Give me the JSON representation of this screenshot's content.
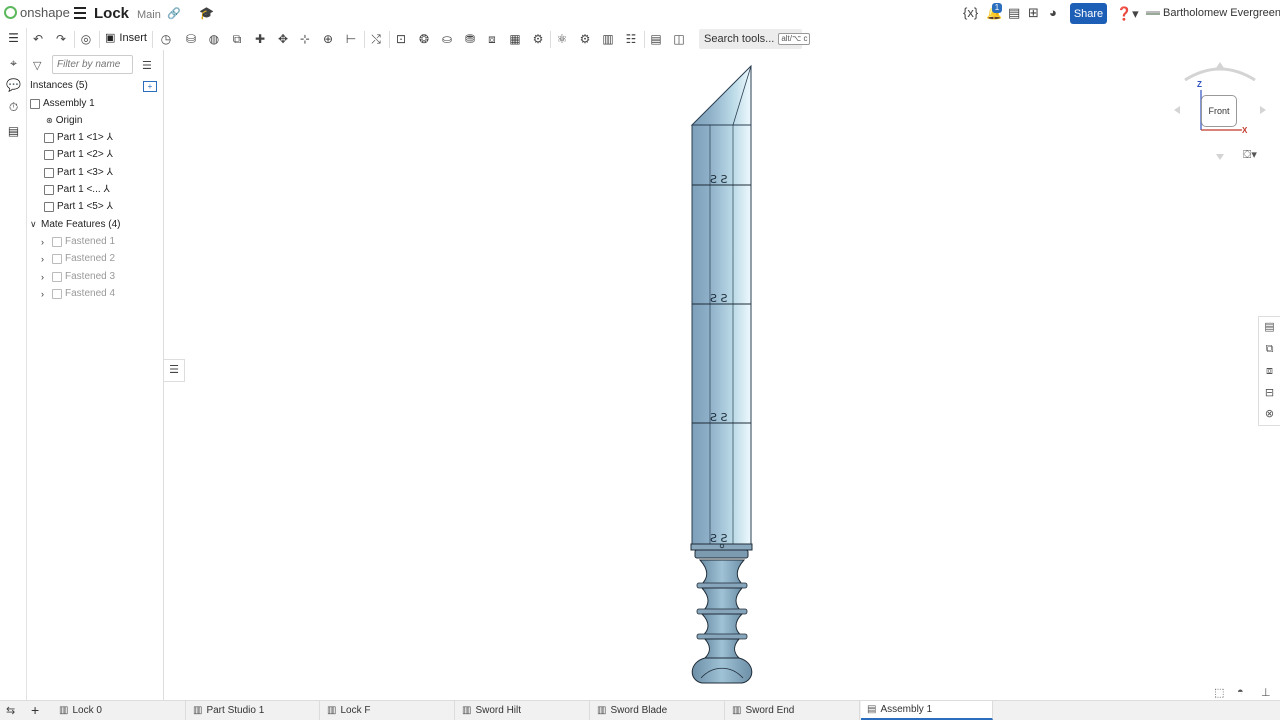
{
  "header": {
    "brand": "onshape",
    "doc_title": "Lock",
    "branch": "Main",
    "notification_count": "1",
    "share_label": "Share",
    "user_name": "Bartholomew Evergreen",
    "icons": [
      "variable-studio-icon",
      "notification-icon",
      "document-icon",
      "apps-icon",
      "learning-icon",
      "help-icon"
    ]
  },
  "toolbar": {
    "insert_label": "Insert",
    "search_label": "Search tools...",
    "search_shortcut": "alt/⌥ c",
    "icons": [
      "undo-icon",
      "redo-icon",
      "render-icon",
      "insert-icon",
      "mate-connector-icon",
      "fastened-mate-icon",
      "revolute-mate-icon",
      "slider-mate-icon",
      "planar-mate-icon",
      "cylindrical-mate-icon",
      "pin-slot-mate-icon",
      "ball-mate-icon",
      "parallel-mate-icon",
      "tangent-mate-icon",
      "group-icon",
      "replicate-icon",
      "mate-relation-icon",
      "gear-relation-icon",
      "rack-pinion-icon",
      "screw-relation-icon",
      "linear-relation-icon",
      "explode-icon",
      "section-view-icon",
      "measure-icon",
      "mass-properties-icon"
    ]
  },
  "left_panel": {
    "filter_placeholder": "Filter by name",
    "instances_header": "Instances (5)",
    "assembly": "Assembly 1",
    "origin": "Origin",
    "parts": [
      "Part 1 <1>",
      "Part 1 <2>",
      "Part 1 <3>",
      "Part 1 <...",
      "Part 1 <5>"
    ],
    "mate_features_header": "Mate Features (4)",
    "mates": [
      "Fastened 1",
      "Fastened 2",
      "Fastened 3",
      "Fastened 4"
    ]
  },
  "viewcube": {
    "face": "Front",
    "axis_z": "Z",
    "axis_x": "X"
  },
  "model": {
    "name": "sword-assembly",
    "blade_fill": "#86a9c3",
    "blade_highlight": "#eaf6fb",
    "segments": 4
  },
  "tabs": [
    {
      "label": "Lock 0",
      "active": false
    },
    {
      "label": "Part Studio 1",
      "active": false
    },
    {
      "label": "Lock F",
      "active": false
    },
    {
      "label": "Sword Hilt",
      "active": false
    },
    {
      "label": "Sword Blade",
      "active": false
    },
    {
      "label": "Sword End",
      "active": false
    },
    {
      "label": "Assembly 1",
      "active": true
    }
  ],
  "colors": {
    "accent": "#1d5fb6",
    "brand_green": "#5cb85c"
  }
}
